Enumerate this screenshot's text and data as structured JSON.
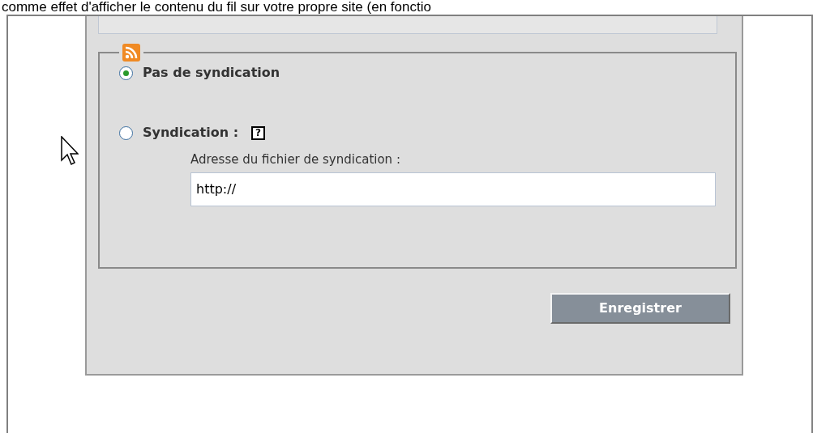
{
  "intro_text": "comme effet d'afficher le contenu du fil sur votre propre site (en fonctio",
  "options": [
    {
      "kind": "plain",
      "label": "Pas de syndication",
      "selected": true
    },
    {
      "kind": "url",
      "label": "Syndication :",
      "selected": false,
      "help": "?",
      "field_label": "Adresse du fichier de syndication :",
      "value": "http://"
    }
  ],
  "save_button": "Enregistrer"
}
